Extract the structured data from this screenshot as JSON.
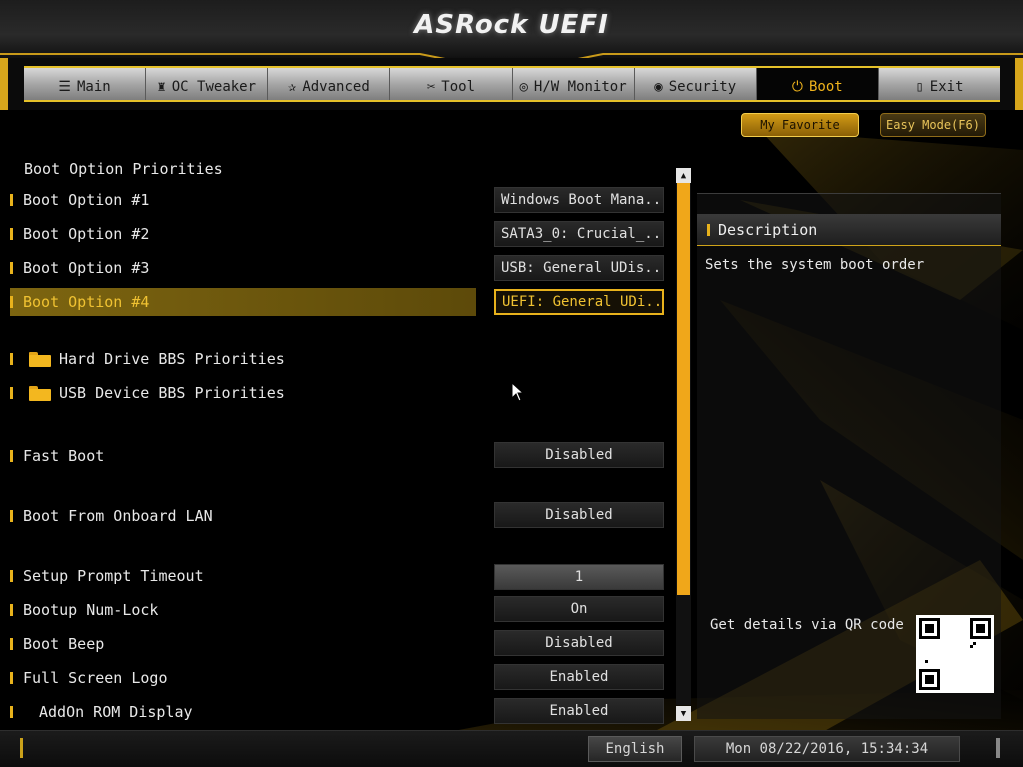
{
  "header": {
    "brand": "ASRock UEFI"
  },
  "nav": {
    "tabs": [
      {
        "label": "Main",
        "icon": "list-icon",
        "glyph": "☰"
      },
      {
        "label": "OC Tweaker",
        "icon": "rocket-icon",
        "glyph": "♜"
      },
      {
        "label": "Advanced",
        "icon": "star-icon",
        "glyph": "✰"
      },
      {
        "label": "Tool",
        "icon": "tools-icon",
        "glyph": "✂"
      },
      {
        "label": "H/W Monitor",
        "icon": "monitor-icon",
        "glyph": "◎"
      },
      {
        "label": "Security",
        "icon": "shield-icon",
        "glyph": "◉"
      },
      {
        "label": "Boot",
        "icon": "power-icon",
        "glyph": "⏻",
        "active": true
      },
      {
        "label": "Exit",
        "icon": "exit-door-icon",
        "glyph": "▯"
      }
    ]
  },
  "toolbar": {
    "favorite_label": "My Favorite",
    "easy_mode_label": "Easy Mode(F6)"
  },
  "boot": {
    "section_title": "Boot Option Priorities",
    "options": [
      {
        "label": "Boot Option #1",
        "value": "Windows Boot Mana..."
      },
      {
        "label": "Boot Option #2",
        "value": "SATA3_0: Crucial_..."
      },
      {
        "label": "Boot Option #3",
        "value": "USB: General UDis..."
      },
      {
        "label": "Boot Option #4",
        "value": "UEFI: General UDi...",
        "selected": true
      }
    ],
    "submenus": [
      {
        "label": "Hard Drive BBS Priorities",
        "icon": "folder-icon"
      },
      {
        "label": "USB Device BBS Priorities",
        "icon": "folder-icon"
      }
    ],
    "fast_boot": {
      "label": "Fast Boot",
      "value": "Disabled"
    },
    "onboard_lan": {
      "label": "Boot From Onboard LAN",
      "value": "Disabled"
    },
    "prompt_timeout": {
      "label": "Setup Prompt Timeout",
      "value": "1"
    },
    "num_lock": {
      "label": "Bootup Num-Lock",
      "value": "On"
    },
    "boot_beep": {
      "label": "Boot Beep",
      "value": "Disabled"
    },
    "full_screen_logo": {
      "label": "Full Screen Logo",
      "value": "Enabled"
    },
    "addon_rom": {
      "label": "AddOn ROM Display",
      "value": "Enabled"
    }
  },
  "description": {
    "title": "Description",
    "text": "Sets the system boot order",
    "qr_label": "Get details via QR code"
  },
  "status": {
    "language": "English",
    "datetime": "Mon 08/22/2016, 15:34:34"
  },
  "colors": {
    "accent": "#f0b41c",
    "selection": "#7d6510",
    "background": "#000000"
  }
}
